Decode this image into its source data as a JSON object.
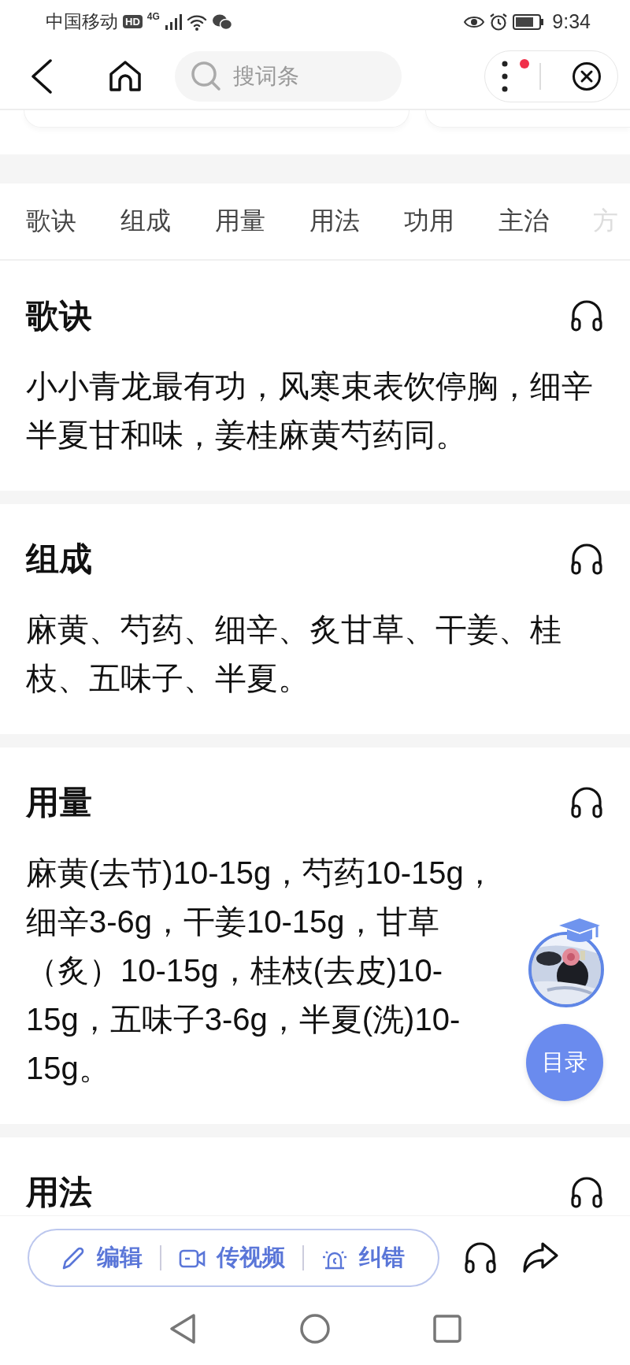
{
  "status_bar": {
    "carrier": "中国移动",
    "hd": "HD",
    "network": "4G",
    "time": "9:34"
  },
  "header": {
    "search": {
      "placeholder": "搜词条"
    },
    "menu_badge": true
  },
  "tabs": [
    {
      "label": "歌诀",
      "selected": false
    },
    {
      "label": "组成",
      "selected": false
    },
    {
      "label": "用量",
      "selected": false
    },
    {
      "label": "用法",
      "selected": false
    },
    {
      "label": "功用",
      "selected": false
    },
    {
      "label": "主治",
      "selected": false
    },
    {
      "label": "方",
      "selected": false,
      "faded": true
    }
  ],
  "sections": [
    {
      "title": "歌诀",
      "body": "小小青龙最有功，风寒束表饮停胸，细辛半夏甘和味，姜桂麻黄芍药同。"
    },
    {
      "title": "组成",
      "body": "麻黄、芍药、细辛、炙甘草、干姜、桂枝、五味子、半夏。"
    },
    {
      "title": "用量",
      "body": "麻黄(去节)10-15g，芍药10-15g，细辛3-6g，干姜10-15g，甘草（炙）10-15g，桂枝(去皮)10-15g，五味子3-6g，半夏(洗)10-15g。"
    },
    {
      "title": "用法"
    }
  ],
  "floating": {
    "toc_label": "目录"
  },
  "bottom_bar": {
    "actions": [
      {
        "label": "编辑",
        "kind": "pencil"
      },
      {
        "label": "传视频",
        "kind": "video"
      },
      {
        "label": "纠错",
        "kind": "alarm"
      }
    ]
  }
}
